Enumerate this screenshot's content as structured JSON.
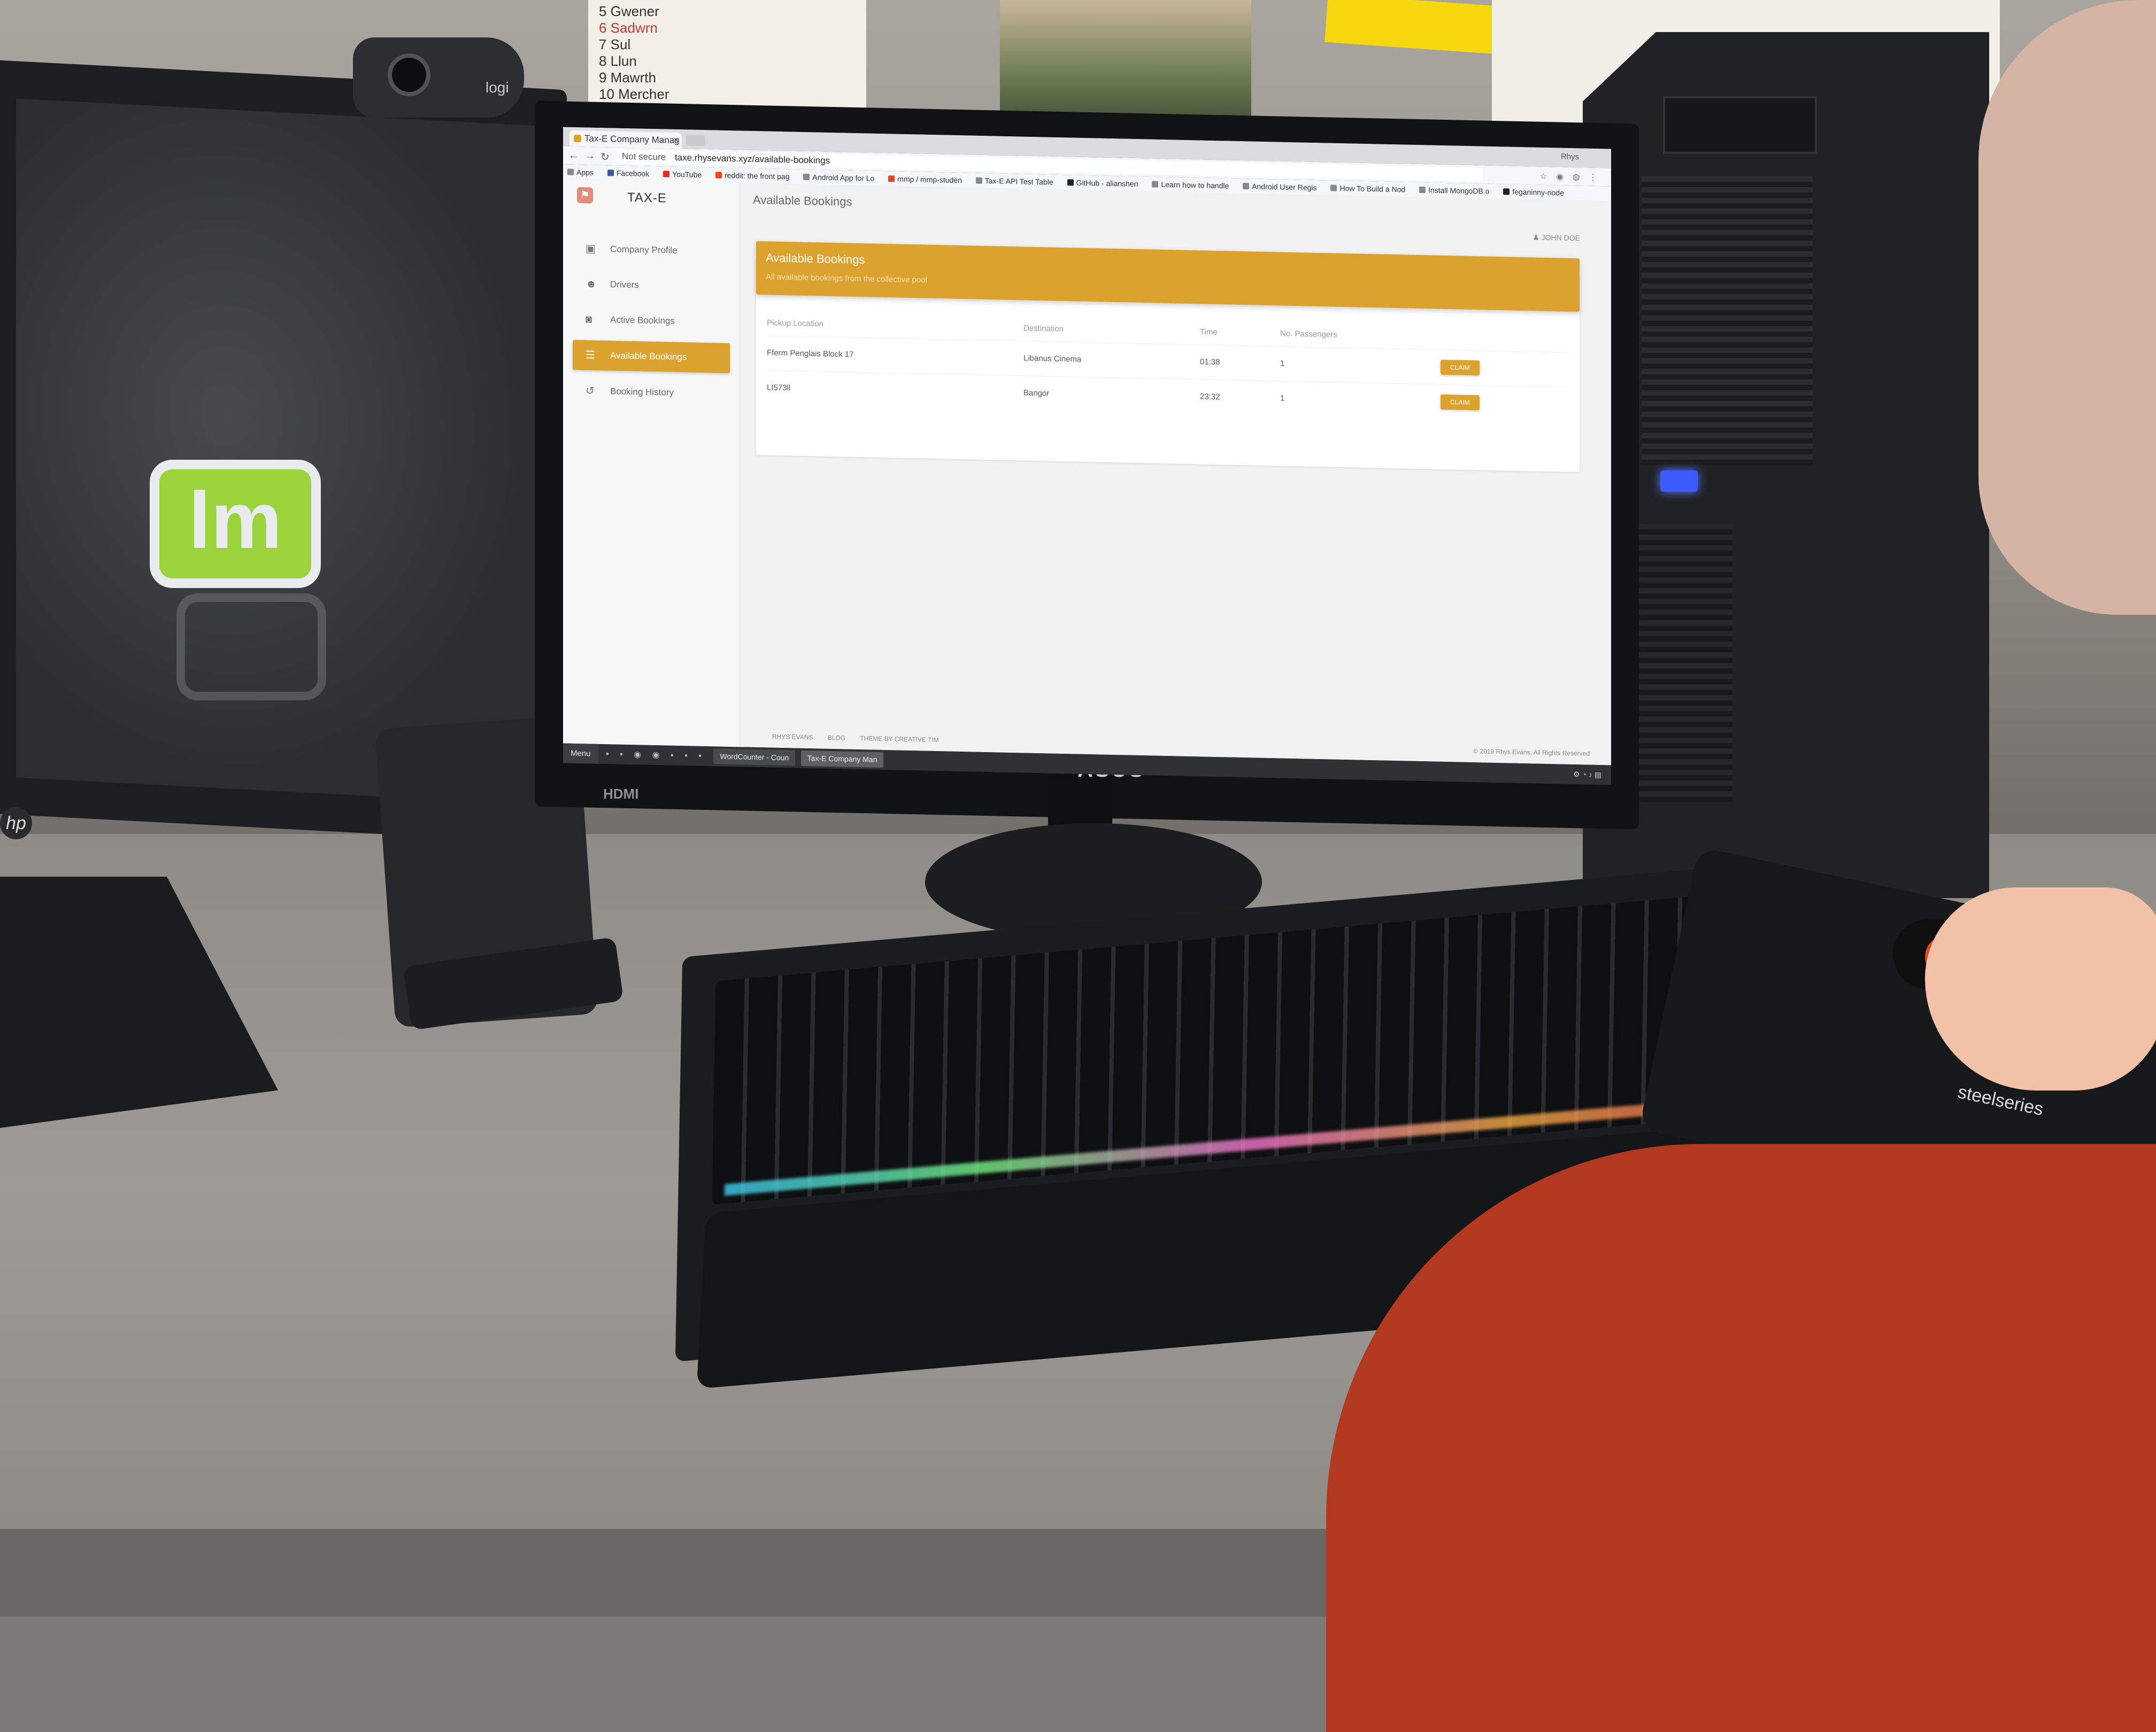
{
  "browser": {
    "tab_title": "Tax-E Company Manag",
    "window_user": "Rhys",
    "url_security": "Not secure",
    "url": "taxe.rhysevans.xyz/available-bookings",
    "bookmarks": [
      "Apps",
      "Facebook",
      "YouTube",
      "reddit: the front pag",
      "Android App for Lo",
      "mmp / mmp-studen",
      "Tax-E API Test Table",
      "GitHub - alianshen",
      "Learn how to handle",
      "Android User Regis",
      "How To Build a Nod",
      "Install MongoDB o",
      "feganinny-node"
    ]
  },
  "sidebar": {
    "brand": "TAX-E",
    "items": [
      {
        "label": "Company Profile",
        "icon": "person-icon"
      },
      {
        "label": "Drivers",
        "icon": "group-icon"
      },
      {
        "label": "Active Bookings",
        "icon": "car-icon"
      },
      {
        "label": "Available Bookings",
        "icon": "list-icon",
        "active": true
      },
      {
        "label": "Booking History",
        "icon": "history-icon"
      }
    ]
  },
  "main": {
    "page_title": "Available Bookings",
    "user": "JOHN DOE",
    "card_title": "Available Bookings",
    "card_subtitle": "All available bookings from the collective pool",
    "columns": [
      "Pickup Location",
      "Destination",
      "Time",
      "No. Passengers"
    ],
    "rows": [
      {
        "pickup": "Fferm Penglais Block 17",
        "destination": "Libanus Cinema",
        "time": "01:38",
        "passengers": "1",
        "action": "CLAIM"
      },
      {
        "pickup": "LI573ll",
        "destination": "Bangor",
        "time": "23:32",
        "passengers": "1",
        "action": "CLAIM"
      }
    ],
    "footer_links": [
      "RHYS EVANS",
      "BLOG"
    ],
    "footer_credit": "THEME BY CREATIVE TIM",
    "copyright": "© 2019 Rhys Evans, All Rights Reserved"
  },
  "taskbar": {
    "start_label": "Menu",
    "windows": [
      "WordCounter - Coun",
      "Tax-E Company Man"
    ]
  },
  "scene": {
    "notes_list": [
      "5 Gwener",
      "6 Sadwrn",
      "7 Sul",
      "8 Llun",
      "9 Mawrth",
      "10 Mercher"
    ],
    "webcam_brand": "logi",
    "monitor_brand": "ASUS",
    "hdmi_label": "HDMI",
    "mousepad_brand": "steelseries"
  },
  "colors": {
    "accent": "#dba22e",
    "taskbar": "#2f3133"
  }
}
